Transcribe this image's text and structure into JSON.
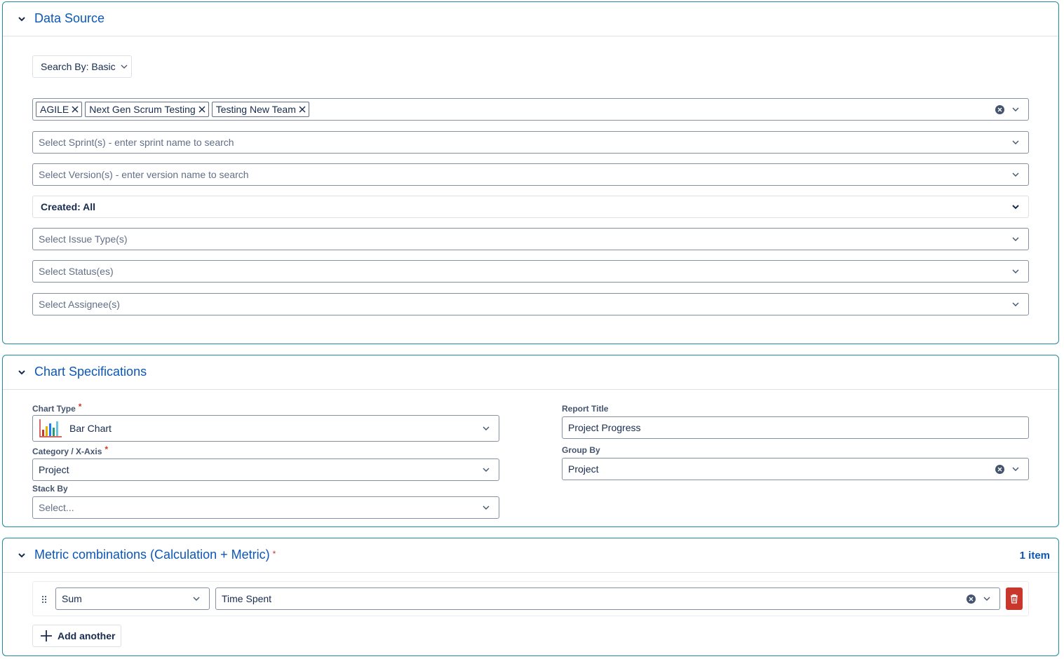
{
  "data_source": {
    "title": "Data Source",
    "search_by": "Search By: Basic",
    "projects": [
      "AGILE",
      "Next Gen Scrum Testing",
      "Testing New Team"
    ],
    "sprint_placeholder": "Select Sprint(s) - enter sprint name to search",
    "version_placeholder": "Select Version(s) - enter version name to search",
    "created": "Created: All",
    "issue_type_placeholder": "Select Issue Type(s)",
    "status_placeholder": "Select Status(es)",
    "assignee_placeholder": "Select Assignee(s)"
  },
  "chart_spec": {
    "title": "Chart Specifications",
    "chart_type_label": "Chart Type",
    "chart_type_value": "Bar Chart",
    "category_label": "Category / X-Axis",
    "category_value": "Project",
    "stack_by_label": "Stack By",
    "stack_by_placeholder": "Select...",
    "report_title_label": "Report Title",
    "report_title_value": "Project Progress",
    "group_by_label": "Group By",
    "group_by_value": "Project"
  },
  "metrics": {
    "title": "Metric combinations (Calculation + Metric)",
    "count": "1 item",
    "calculation": "Sum",
    "metric": "Time Spent",
    "add_label": "Add another"
  },
  "colors": {
    "accent": "#0b57b7",
    "panel_border": "#1f8c9e",
    "danger": "#c9372c"
  }
}
